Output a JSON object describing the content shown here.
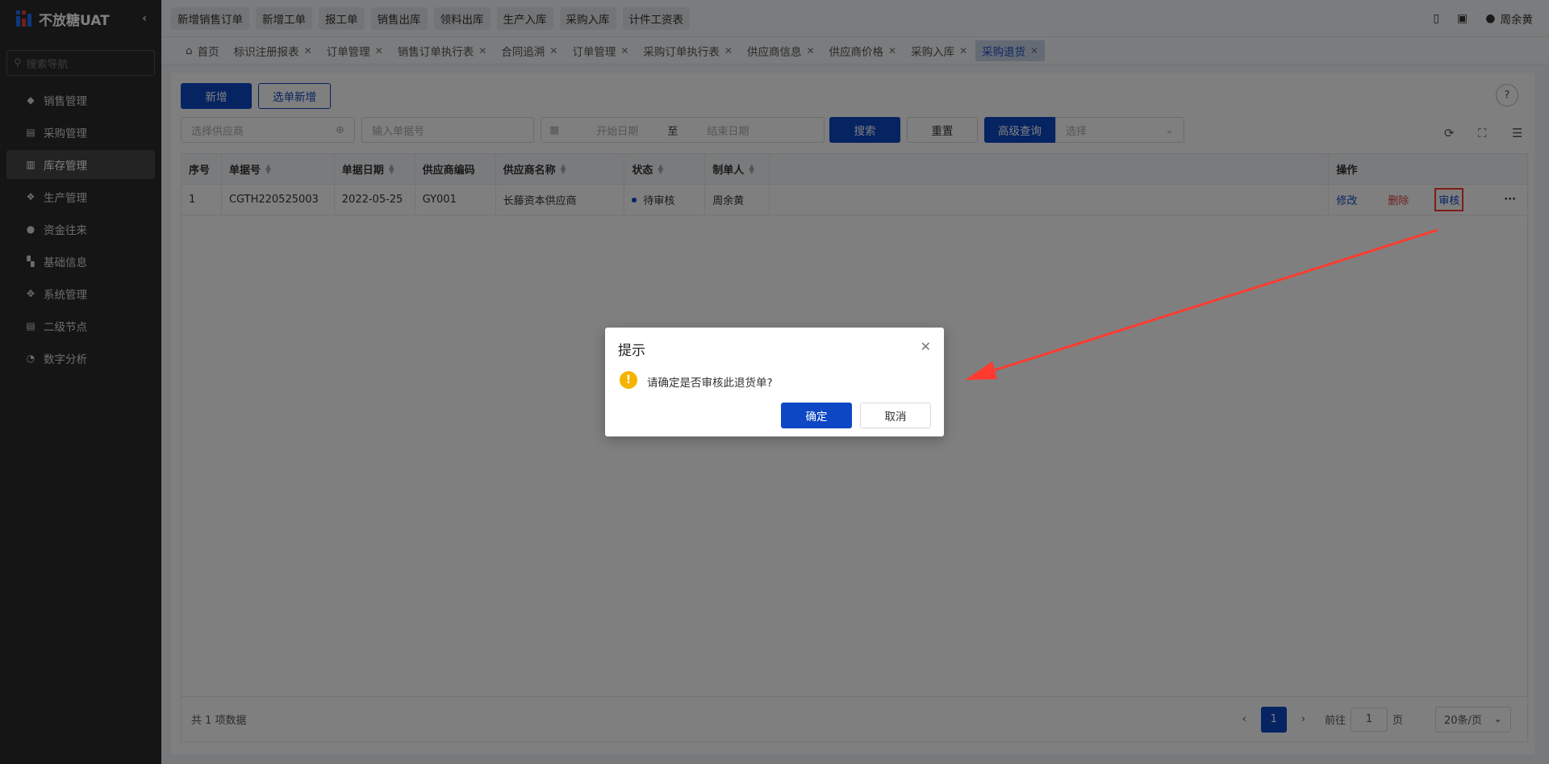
{
  "app": {
    "title": "不放糖UAT",
    "collapse_icon": "chevron-left-icon"
  },
  "sidebar": {
    "search_placeholder": "搜索导航",
    "items": [
      {
        "label": "销售管理",
        "icon": "tag-icon",
        "active": false
      },
      {
        "label": "采购管理",
        "icon": "cart-icon",
        "active": false
      },
      {
        "label": "库存管理",
        "icon": "warehouse-icon",
        "active": true
      },
      {
        "label": "生产管理",
        "icon": "production-icon",
        "active": false
      },
      {
        "label": "资金往来",
        "icon": "money-icon",
        "active": false
      },
      {
        "label": "基础信息",
        "icon": "grid-icon",
        "active": false
      },
      {
        "label": "系统管理",
        "icon": "system-icon",
        "active": false
      },
      {
        "label": "二级节点",
        "icon": "document-icon",
        "active": false
      },
      {
        "label": "数字分析",
        "icon": "pie-icon",
        "active": false
      }
    ]
  },
  "topbar": {
    "quick_links": [
      "新增销售订单",
      "新增工单",
      "报工单",
      "销售出库",
      "领料出库",
      "生产入库",
      "采购入库",
      "计件工资表"
    ],
    "user": "周余黄"
  },
  "tabs": [
    {
      "label": "首页",
      "closable": false,
      "active": false
    },
    {
      "label": "标识注册报表",
      "closable": true,
      "active": false
    },
    {
      "label": "订单管理",
      "closable": true,
      "active": false
    },
    {
      "label": "销售订单执行表",
      "closable": true,
      "active": false
    },
    {
      "label": "合同追溯",
      "closable": true,
      "active": false
    },
    {
      "label": "订单管理",
      "closable": true,
      "active": false
    },
    {
      "label": "采购订单执行表",
      "closable": true,
      "active": false
    },
    {
      "label": "供应商信息",
      "closable": true,
      "active": false
    },
    {
      "label": "供应商价格",
      "closable": true,
      "active": false
    },
    {
      "label": "采购入库",
      "closable": true,
      "active": false
    },
    {
      "label": "采购退货",
      "closable": true,
      "active": true
    }
  ],
  "toolbar": {
    "add": "新增",
    "select_add": "选单新增",
    "supplier_placeholder": "选择供应商",
    "doc_no_placeholder": "输入单据号",
    "start_date_placeholder": "开始日期",
    "date_sep": "至",
    "end_date_placeholder": "结束日期",
    "search": "搜索",
    "reset": "重置",
    "advanced": "高级查询",
    "advanced_select_placeholder": "选择"
  },
  "table": {
    "columns": [
      "序号",
      "单据号",
      "单据日期",
      "供应商编码",
      "供应商名称",
      "状态",
      "制单人",
      "操作"
    ],
    "rows": [
      {
        "index": "1",
        "doc_no": "CGTH220525003",
        "date": "2022-05-25",
        "supplier_code": "GY001",
        "supplier_name": "长藤资本供应商",
        "status": "待审核",
        "creator": "周余黄",
        "actions": [
          "修改",
          "删除",
          "审核"
        ]
      }
    ]
  },
  "footer": {
    "total": "共 1 项数据",
    "current_page": "1",
    "goto_label": "前往",
    "goto_value": "1",
    "page_suffix": "页",
    "page_size": "20条/页"
  },
  "dialog": {
    "title": "提示",
    "message": "请确定是否审核此退货单?",
    "confirm": "确定",
    "cancel": "取消"
  },
  "colors": {
    "primary": "#0d47c4",
    "danger": "#e23c3c",
    "annotation": "#ff3b30",
    "warning": "#f4b400"
  }
}
